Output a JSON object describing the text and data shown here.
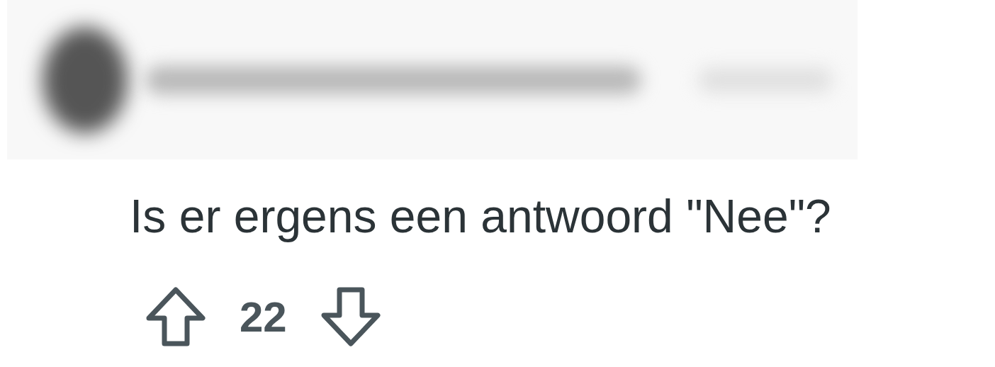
{
  "comment": {
    "body": "Is er ergens een antwoord \"Nee\"?"
  },
  "votes": {
    "score": "22"
  }
}
